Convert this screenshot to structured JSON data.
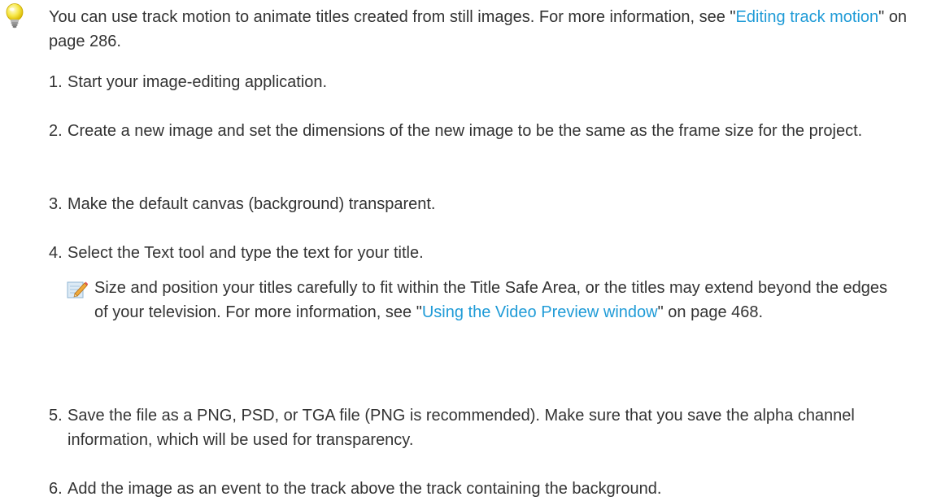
{
  "tip": {
    "icon": "lightbulb-icon",
    "text_before": "You can use track motion to animate titles created from still images. For more information, see \"",
    "link": "Editing track motion",
    "text_after": "\" on page 286."
  },
  "steps": [
    {
      "num": "1.",
      "text": "Start your image-editing application."
    },
    {
      "num": "2.",
      "text": "Create a new image and set the dimensions of the new image to be the same as the frame size for the project."
    },
    {
      "num": "3.",
      "text": "Make the default canvas (background) transparent."
    },
    {
      "num": "4.",
      "text": "Select the Text tool and type the text for your title."
    },
    {
      "num": "5.",
      "text": "Save the file as a PNG, PSD, or TGA file (PNG is recommended). Make sure that you save the alpha channel information, which will be used for transparency."
    },
    {
      "num": "6.",
      "text": "Add the image as an event to the track above the track containing the background."
    }
  ],
  "note": {
    "icon": "note-pencil-icon",
    "text_before": "Size and position your titles carefully to fit within the Title Safe Area, or the titles may extend beyond the edges of your television. For more information, see \"",
    "link": "Using the Video Preview window",
    "text_after": "\" on page 468."
  },
  "colors": {
    "link": "#1f9bd7",
    "text": "#333333"
  }
}
